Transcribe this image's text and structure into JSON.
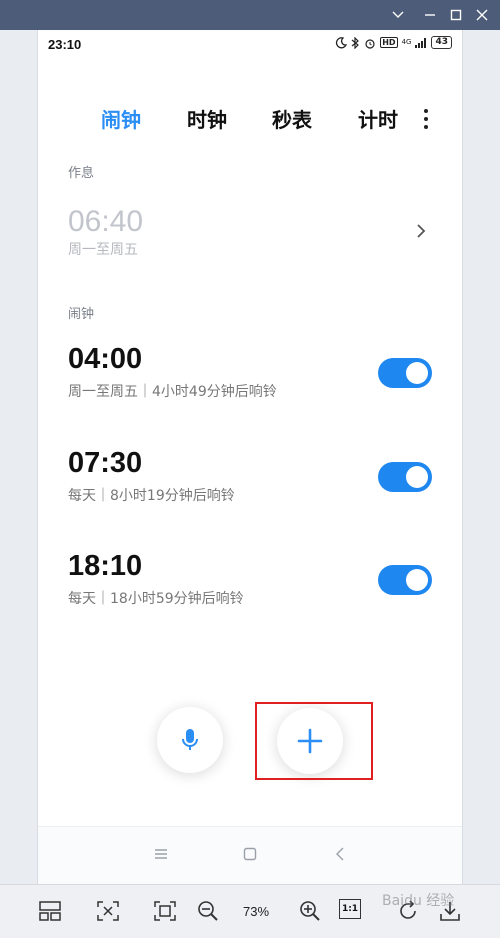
{
  "status_bar": {
    "time": "23:10",
    "battery": "43",
    "network": "4G"
  },
  "tabs": [
    {
      "label": "闹钟",
      "active": true
    },
    {
      "label": "时钟",
      "active": false
    },
    {
      "label": "秒表",
      "active": false
    },
    {
      "label": "计时",
      "active": false
    }
  ],
  "rest_section": {
    "label": "作息",
    "time": "06:40",
    "repeat": "周一至周五"
  },
  "alarm_section": {
    "label": "闹钟"
  },
  "alarms": [
    {
      "time": "04:00",
      "detail": "周一至周五｜4小时49分钟后响铃",
      "enabled": true
    },
    {
      "time": "07:30",
      "detail": "每天｜8小时19分钟后响铃",
      "enabled": true
    },
    {
      "time": "18:10",
      "detail": "每天｜18小时59分钟后响铃",
      "enabled": true
    }
  ],
  "toolbar": {
    "zoom": "73%",
    "one_to_one": "1:1"
  },
  "watermark": "Baidu 经验",
  "colors": {
    "accent": "#2b8ef5",
    "toggle_on": "#1f88f0",
    "highlight": "#e02020",
    "titlebar": "#4d5c79"
  }
}
